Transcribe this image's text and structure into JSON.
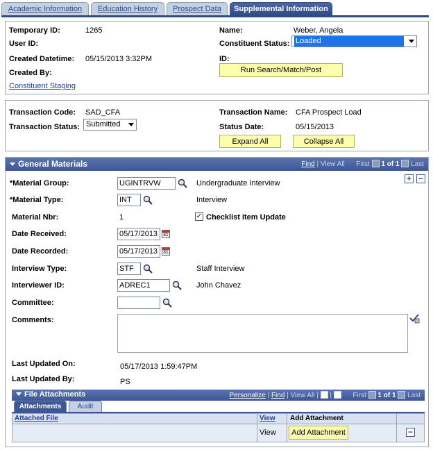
{
  "tabs": [
    {
      "label": "Academic Information"
    },
    {
      "label": "Education History"
    },
    {
      "label": "Prospect Data"
    },
    {
      "label": "Supplemental Information"
    }
  ],
  "header": {
    "temp_id_label": "Temporary ID:",
    "temp_id_value": "1265",
    "user_id_label": "User ID:",
    "created_dt_label": "Created Datetime:",
    "created_dt_value": "05/15/2013  3:32PM",
    "created_by_label": "Created By:",
    "constituent_staging_link": "Constituent Staging",
    "name_label": "Name:",
    "name_value": "Weber, Angela",
    "constituent_status_label": "Constituent Status:",
    "constituent_status_value": "Loaded",
    "id_label": "ID:",
    "run_button": "Run Search/Match/Post"
  },
  "transaction": {
    "code_label": "Transaction Code:",
    "code_value": "SAD_CFA",
    "status_label": "Transaction Status:",
    "status_value": "Submitted",
    "name_label": "Transaction Name:",
    "name_value": "CFA Prospect Load",
    "status_date_label": "Status Date:",
    "status_date_value": "05/15/2013",
    "expand_all": "Expand All",
    "collapse_all": "Collapse All"
  },
  "general": {
    "title": "General Materials",
    "nav_find": "Find",
    "nav_sep1": "|",
    "nav_view_all": "View All",
    "nav_first": "First",
    "nav_count": "1 of 1",
    "nav_last": "Last",
    "material_group_label": "*Material Group:",
    "material_group_value": "UGINTRVW",
    "material_group_desc": "Undergraduate Interview",
    "material_type_label": "*Material Type:",
    "material_type_value": "INT",
    "material_type_desc": "Interview",
    "material_nbr_label": "Material Nbr:",
    "material_nbr_value": "1",
    "checklist_label": "Checklist Item Update",
    "date_received_label": "Date Received:",
    "date_received_value": "05/17/2013",
    "date_recorded_label": "Date Recorded:",
    "date_recorded_value": "05/17/2013",
    "interview_type_label": "Interview Type:",
    "interview_type_value": "STF",
    "interview_type_desc": "Staff Interview",
    "interviewer_id_label": "Interviewer ID:",
    "interviewer_id_value": "ADREC1",
    "interviewer_name": "John Chavez",
    "committee_label": "Committee:",
    "committee_value": "",
    "comments_label": "Comments:",
    "last_updated_on_label": "Last Updated On:",
    "last_updated_on_value": "05/17/2013  1:59:47PM",
    "last_updated_by_label": "Last Updated By:",
    "last_updated_by_value": "PS"
  },
  "attachments": {
    "title": "File Attachments",
    "nav_personalize": "Personalize",
    "nav_find": "Find",
    "nav_view_all": "View All",
    "nav_first": "First",
    "nav_count": "1 of 1",
    "nav_last": "Last",
    "subtab_attachments": "Attachments",
    "subtab_audit": "Audit",
    "col_attached_file": "Attached File",
    "col_view": "View",
    "col_add": "Add Attachment",
    "row_view": "View",
    "row_add_button": "Add Attachment"
  }
}
